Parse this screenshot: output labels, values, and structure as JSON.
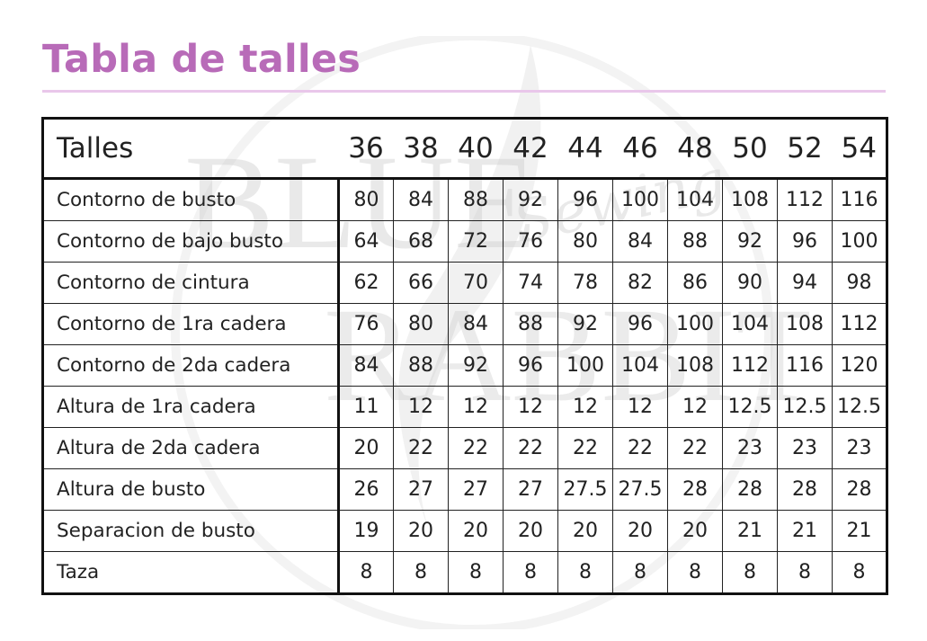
{
  "title": "Tabla de talles",
  "watermark": {
    "text_top": "BLUE",
    "text_bottom": "RABBIT",
    "script_text": "Sewing"
  },
  "table": {
    "header_label": "Talles",
    "sizes": [
      "36",
      "38",
      "40",
      "42",
      "44",
      "46",
      "48",
      "50",
      "52",
      "54"
    ],
    "rows": [
      {
        "label": "Contorno de busto",
        "values": [
          "80",
          "84",
          "88",
          "92",
          "96",
          "100",
          "104",
          "108",
          "112",
          "116"
        ]
      },
      {
        "label": "Contorno de bajo busto",
        "values": [
          "64",
          "68",
          "72",
          "76",
          "80",
          "84",
          "88",
          "92",
          "96",
          "100"
        ]
      },
      {
        "label": "Contorno de cintura",
        "values": [
          "62",
          "66",
          "70",
          "74",
          "78",
          "82",
          "86",
          "90",
          "94",
          "98"
        ]
      },
      {
        "label": "Contorno de 1ra cadera",
        "values": [
          "76",
          "80",
          "84",
          "88",
          "92",
          "96",
          "100",
          "104",
          "108",
          "112"
        ]
      },
      {
        "label": "Contorno de 2da cadera",
        "values": [
          "84",
          "88",
          "92",
          "96",
          "100",
          "104",
          "108",
          "112",
          "116",
          "120"
        ]
      },
      {
        "label": "Altura de 1ra cadera",
        "values": [
          "11",
          "12",
          "12",
          "12",
          "12",
          "12",
          "12",
          "12.5",
          "12.5",
          "12.5"
        ]
      },
      {
        "label": "Altura de 2da cadera",
        "values": [
          "20",
          "22",
          "22",
          "22",
          "22",
          "22",
          "22",
          "23",
          "23",
          "23"
        ]
      },
      {
        "label": "Altura de busto",
        "values": [
          "26",
          "27",
          "27",
          "27",
          "27.5",
          "27.5",
          "28",
          "28",
          "28",
          "28"
        ]
      },
      {
        "label": "Separacion de busto",
        "values": [
          "19",
          "20",
          "20",
          "20",
          "20",
          "20",
          "20",
          "21",
          "21",
          "21"
        ]
      },
      {
        "label": "Taza",
        "values": [
          "8",
          "8",
          "8",
          "8",
          "8",
          "8",
          "8",
          "8",
          "8",
          "8"
        ]
      }
    ]
  },
  "colors": {
    "title": "#b86bb8",
    "rule": "#e9c7ea",
    "border": "#111111",
    "text": "#222222",
    "watermark": "#cfcfcf"
  }
}
